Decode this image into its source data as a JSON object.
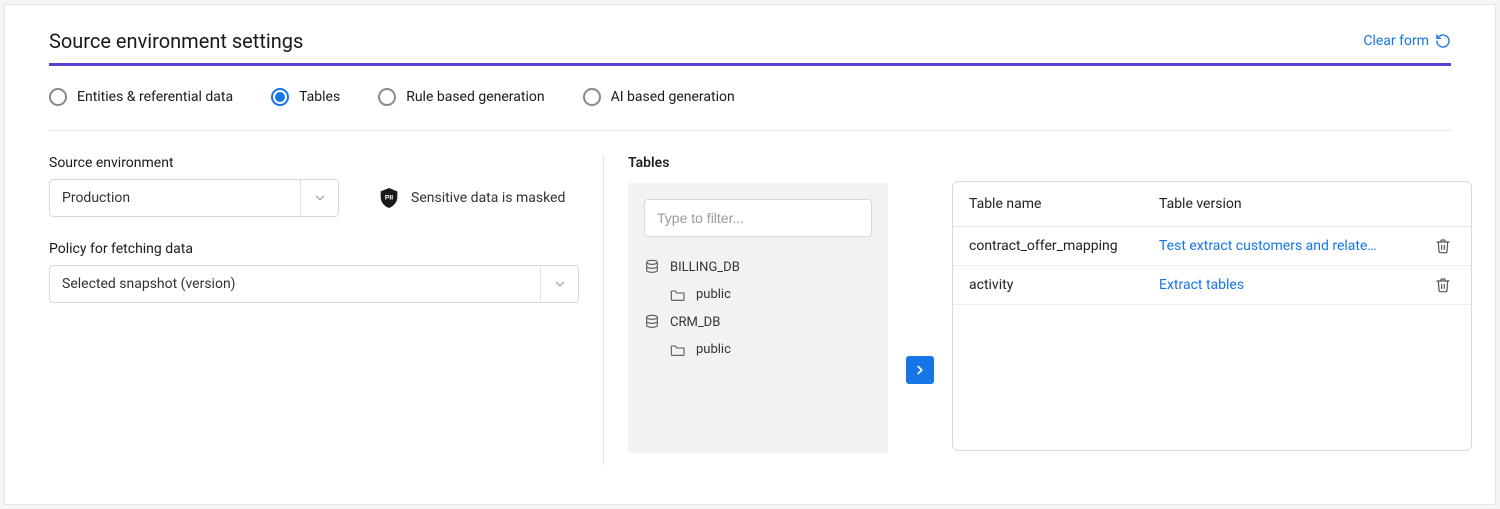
{
  "header": {
    "title": "Source environment settings",
    "clear_label": "Clear form"
  },
  "tabs": [
    {
      "label": "Entities & referential data",
      "selected": false
    },
    {
      "label": "Tables",
      "selected": true
    },
    {
      "label": "Rule based generation",
      "selected": false
    },
    {
      "label": "AI based generation",
      "selected": false
    }
  ],
  "left": {
    "source_env_label": "Source environment",
    "source_env_value": "Production",
    "masked_label": "Sensitive data is masked",
    "policy_label": "Policy for fetching data",
    "policy_value": "Selected snapshot (version)"
  },
  "tables_panel": {
    "heading": "Tables",
    "filter_placeholder": "Type to filter...",
    "databases": [
      {
        "name": "BILLING_DB",
        "schemas": [
          "public"
        ]
      },
      {
        "name": "CRM_DB",
        "schemas": [
          "public"
        ]
      }
    ]
  },
  "result_table": {
    "columns": {
      "name": "Table name",
      "version": "Table version"
    },
    "rows": [
      {
        "name": "contract_offer_mapping",
        "version": "Test extract customers and relate…"
      },
      {
        "name": "activity",
        "version": "Extract tables"
      }
    ]
  }
}
